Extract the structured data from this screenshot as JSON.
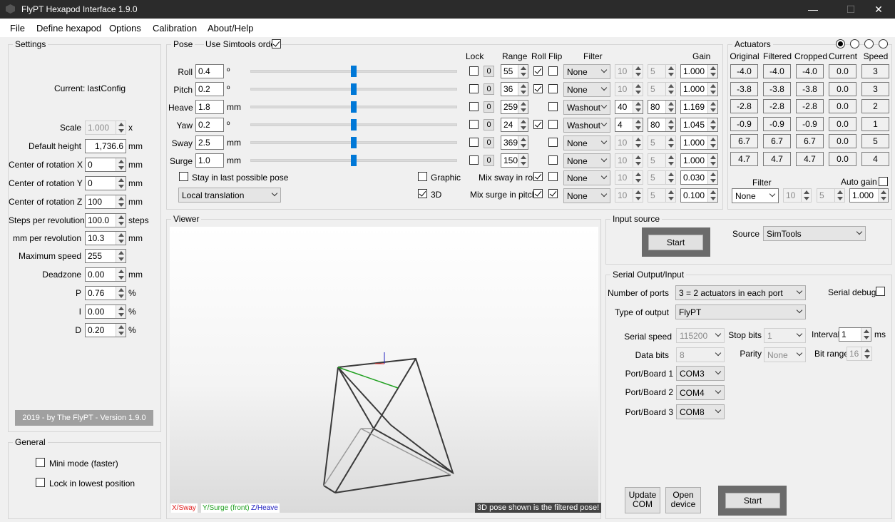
{
  "window": {
    "title": "FlyPT Hexapod Interface 1.9.0",
    "minimize": "—",
    "maximize": "☐",
    "close": "✕"
  },
  "menu": [
    "File",
    "Define hexapod",
    "Options",
    "Calibration",
    "About/Help"
  ],
  "settings": {
    "group_label": "Settings",
    "current": "Current: lastConfig",
    "fields": [
      {
        "label": "Scale",
        "value": "1.000",
        "unit": "x"
      },
      {
        "label": "Default height",
        "value": "1,736.6",
        "unit": "mm"
      },
      {
        "label": "Center of rotation X",
        "value": "0",
        "unit": "mm"
      },
      {
        "label": "Center of rotation Y",
        "value": "0",
        "unit": "mm"
      },
      {
        "label": "Center of rotation Z",
        "value": "100",
        "unit": "mm"
      },
      {
        "label": "Steps per revolution",
        "value": "100.0",
        "unit": "steps"
      },
      {
        "label": "mm per revolution",
        "value": "10.3",
        "unit": "mm"
      },
      {
        "label": "Maximum speed",
        "value": "255",
        "unit": ""
      },
      {
        "label": "Deadzone",
        "value": "0.00",
        "unit": "mm"
      },
      {
        "label": "P",
        "value": "0.76",
        "unit": "%"
      },
      {
        "label": "I",
        "value": "0.00",
        "unit": "%"
      },
      {
        "label": "D",
        "value": "0.20",
        "unit": "%"
      }
    ],
    "version": "2019 - by The FlyPT - Version 1.9.0"
  },
  "general": {
    "group_label": "General",
    "mini_mode": "Mini mode (faster)",
    "lock_lowest": "Lock in lowest position"
  },
  "pose": {
    "group_label": "Pose",
    "use_simtools": "Use Simtools order",
    "headers": {
      "lock": "Lock",
      "range": "Range",
      "roll": "Roll",
      "flip": "Flip",
      "filter": "Filter",
      "gain": "Gain"
    },
    "rows": [
      {
        "label": "Roll",
        "value": "0.4",
        "unit": "º",
        "slider": 0.5,
        "lock": "0",
        "range": "55",
        "roll": true,
        "flip": false,
        "filter": "None",
        "f1": "10",
        "f2": "5",
        "f_enabled": false,
        "gain": "1.000"
      },
      {
        "label": "Pitch",
        "value": "0.2",
        "unit": "º",
        "slider": 0.5,
        "lock": "0",
        "range": "36",
        "roll": true,
        "flip": false,
        "filter": "None",
        "f1": "10",
        "f2": "5",
        "f_enabled": false,
        "gain": "1.000"
      },
      {
        "label": "Heave",
        "value": "1.8",
        "unit": "mm",
        "slider": 0.5,
        "lock": "0",
        "range": "259",
        "roll": null,
        "flip": false,
        "filter": "Washout",
        "f1": "40",
        "f2": "80",
        "f_enabled": true,
        "gain": "1.169"
      },
      {
        "label": "Yaw",
        "value": "0.2",
        "unit": "º",
        "slider": 0.5,
        "lock": "0",
        "range": "24",
        "roll": true,
        "flip": false,
        "filter": "Washout",
        "f1": "4",
        "f2": "80",
        "f_enabled": true,
        "gain": "1.045"
      },
      {
        "label": "Sway",
        "value": "2.5",
        "unit": "mm",
        "slider": 0.5,
        "lock": "0",
        "range": "369",
        "roll": null,
        "flip": false,
        "filter": "None",
        "f1": "10",
        "f2": "5",
        "f_enabled": false,
        "gain": "1.000"
      },
      {
        "label": "Surge",
        "value": "1.0",
        "unit": "mm",
        "slider": 0.5,
        "lock": "0",
        "range": "150",
        "roll": null,
        "flip": false,
        "filter": "None",
        "f1": "10",
        "f2": "5",
        "f_enabled": false,
        "gain": "1.000"
      }
    ],
    "stay_last": "Stay in last possible pose",
    "translation": "Local translation",
    "graphic": "Graphic",
    "three_d": "3D",
    "mix_sway": "Mix sway in roll",
    "mix_surge": "Mix surge in pitch",
    "mix_rows": [
      {
        "filter": "None",
        "f1": "10",
        "f2": "5",
        "gain": "0.030"
      },
      {
        "filter": "None",
        "f1": "10",
        "f2": "5",
        "gain": "0.100"
      }
    ]
  },
  "actuators": {
    "group_label": "Actuators",
    "headers": [
      "Original",
      "Filtered",
      "Cropped",
      "Current",
      "Speed"
    ],
    "rows": [
      [
        "-4.0",
        "-4.0",
        "-4.0",
        "0.0",
        "3"
      ],
      [
        "-3.8",
        "-3.8",
        "-3.8",
        "0.0",
        "3"
      ],
      [
        "-2.8",
        "-2.8",
        "-2.8",
        "0.0",
        "2"
      ],
      [
        "-0.9",
        "-0.9",
        "-0.9",
        "0.0",
        "1"
      ],
      [
        "6.7",
        "6.7",
        "6.7",
        "0.0",
        "5"
      ],
      [
        "4.7",
        "4.7",
        "4.7",
        "0.0",
        "4"
      ]
    ],
    "filter_label": "Filter",
    "filter": "None",
    "f1": "10",
    "f2": "5",
    "auto_gain": "Auto gain",
    "gain": "1.000"
  },
  "viewer": {
    "group_label": "Viewer",
    "legend_x": "X/Sway",
    "legend_y": "Y/Surge (front)",
    "legend_z": "Z/Heave",
    "note": "3D pose shown is the filtered pose!",
    "colors": {
      "x": "#e02020",
      "y": "#20a020",
      "z": "#2020c0"
    }
  },
  "input_source": {
    "group_label": "Input source",
    "start": "Start",
    "source_label": "Source",
    "source": "SimTools"
  },
  "serial": {
    "group_label": "Serial Output/Input",
    "ports_label": "Number of ports",
    "ports": "3 = 2 actuators in each port",
    "serial_debug": "Serial debug",
    "output_label": "Type of output",
    "output": "FlyPT",
    "speed_label": "Serial speed",
    "speed": "115200",
    "stop_label": "Stop bits",
    "stop": "1",
    "interval_label": "Interval",
    "interval": "1",
    "interval_unit": "ms",
    "data_label": "Data bits",
    "data": "8",
    "parity_label": "Parity",
    "parity": "None",
    "bitrange_label": "Bit range",
    "bitrange": "16",
    "port1_label": "Port/Board 1",
    "port1": "COM3",
    "port2_label": "Port/Board 2",
    "port2": "COM4",
    "port3_label": "Port/Board 3",
    "port3": "COM8",
    "update_com": "Update COM",
    "open_device": "Open device",
    "start": "Start"
  }
}
